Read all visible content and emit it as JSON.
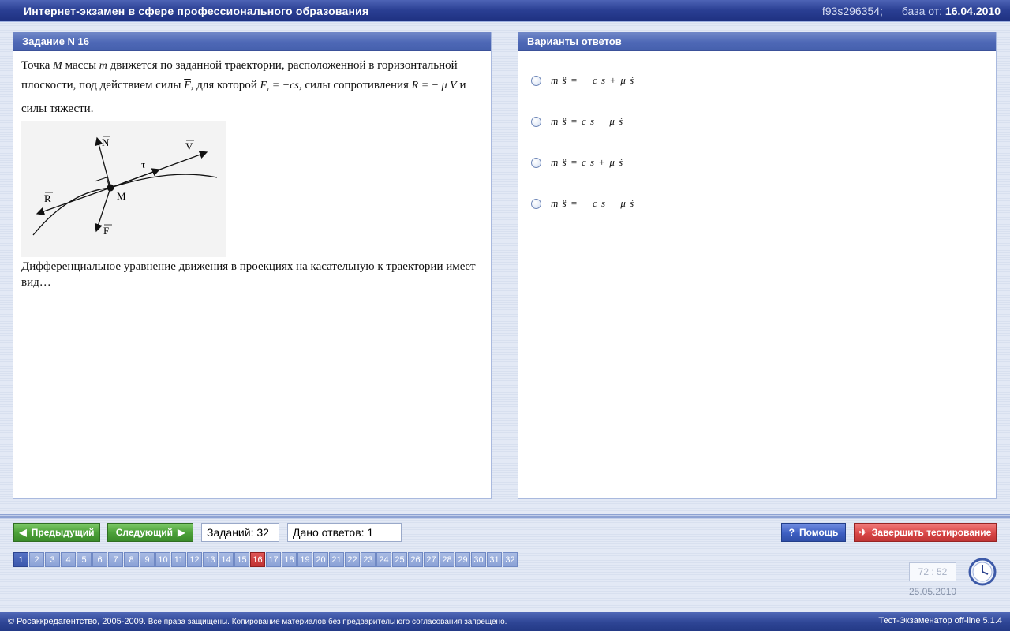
{
  "window": {
    "title": "Интернет-экзамен в сфере профессионального образования",
    "session_code": "f93s296354;",
    "db_label": "база от:",
    "db_date": "16.04.2010"
  },
  "task": {
    "header": "Задание N 16",
    "text_parts": {
      "p1": "Точка",
      "m_sym": "M",
      "p2": "массы",
      "mass_sym": "m",
      "p3": "движется  по заданной траектории, расположенной в горизонтальной плоскости, под действием силы",
      "f_sym": "F",
      "p4": ", для которой",
      "ftau_expr": "F",
      "ftau_rhs": "= −cs",
      "p5": ", силы сопротивления",
      "r_expr": "R = − μ V",
      "p6": "и силы тяжести."
    },
    "figure": {
      "labels": {
        "N": "N",
        "V": "V",
        "tau": "τ",
        "R": "R",
        "M": "M",
        "F": "F"
      }
    },
    "question_line1": "Дифференциальное уравнение движения в проекциях на касательную к траектории имеет",
    "question_line2": "вид…"
  },
  "answers": {
    "header": "Варианты ответов",
    "options": [
      "m s̈ = − c s + μ ṡ",
      "m s̈ = c s − μ ṡ",
      "m s̈ = c s + μ ṡ",
      "m s̈ = − c s − μ ṡ"
    ]
  },
  "nav": {
    "prev_label": "Предыдущий",
    "next_label": "Следующий",
    "tasks_count_text": "Заданий: 32",
    "answers_given_text": "Дано ответов: 1",
    "help_label": "Помощь",
    "finish_label": "Завершить тестирование"
  },
  "pager": {
    "pages": [
      "1",
      "2",
      "3",
      "4",
      "5",
      "6",
      "7",
      "8",
      "9",
      "10",
      "11",
      "12",
      "13",
      "14",
      "15",
      "16",
      "17",
      "18",
      "19",
      "20",
      "21",
      "22",
      "23",
      "24",
      "25",
      "26",
      "27",
      "28",
      "29",
      "30",
      "31",
      "32"
    ],
    "current": "16",
    "answered": [
      "1"
    ]
  },
  "timer": {
    "value": "72 : 52",
    "date": "25.05.2010"
  },
  "footer": {
    "copyright_main": "© Росаккредагентство, 2005-2009.",
    "copyright_rest": "Все права защищены. Копирование материалов без предварительного согласования запрещено.",
    "version": "Тест-Экзаменатор off-line 5.1.4"
  },
  "colors": {
    "title_bar": "#2a3f93",
    "panel_header": "#4e68b6",
    "current_page": "#c03030",
    "answered_page": "#3b57ac",
    "nav_green": "#4da23a",
    "help_blue": "#3e5fc2",
    "finish_red": "#d94747"
  }
}
